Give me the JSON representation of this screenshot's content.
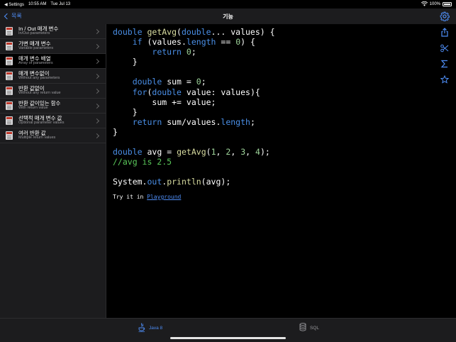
{
  "status_bar": {
    "back_app": "◀ Settings",
    "time": "10:55 AM",
    "date": "Tue Jul 13",
    "battery": "100%"
  },
  "nav": {
    "back_label": "목록",
    "title": "기능"
  },
  "sidebar": {
    "items": [
      {
        "title": "In / Out 매개 변수",
        "subtitle": "In/Out parameters"
      },
      {
        "title": "가변 매개 변수",
        "subtitle": "Variable parameters"
      },
      {
        "title": "매개 변수 배열",
        "subtitle": "Array of parameters"
      },
      {
        "title": "매개 변수없이",
        "subtitle": "Without any parameters"
      },
      {
        "title": "반환 값없이",
        "subtitle": "Without any return value"
      },
      {
        "title": "반환 값이있는 함수",
        "subtitle": "With return value"
      },
      {
        "title": "선택적 매개 변수 값",
        "subtitle": "Optional parameter values"
      },
      {
        "title": "여러 반환 값",
        "subtitle": "Multiple return values"
      }
    ],
    "active_index": 2
  },
  "code": {
    "lines": [
      "double getAvg(double... values) {",
      "    if (values.length == 0) {",
      "        return 0;",
      "    }",
      "",
      "    double sum = 0;",
      "    for(double value: values){",
      "        sum += value;",
      "    }",
      "    return sum/values.length;",
      "}",
      "",
      "double avg = getAvg(1, 2, 3, 4);",
      "//avg is 2.5",
      "",
      "System.out.println(avg);"
    ],
    "try_prefix": "Try it in ",
    "try_link": "Playground"
  },
  "right_toolbar": [
    "share-icon",
    "scissors-icon",
    "sigma-icon",
    "star-icon"
  ],
  "tabs": [
    {
      "label": "Java 8",
      "icon": "java-cup-icon",
      "active": true
    },
    {
      "label": "SQL",
      "icon": "database-icon",
      "active": false
    }
  ],
  "colors": {
    "accent": "#4e8df5",
    "keyword": "#4a8fe7",
    "number": "#9ed49a",
    "comment": "#5ac85a",
    "function": "#d8dca0"
  }
}
